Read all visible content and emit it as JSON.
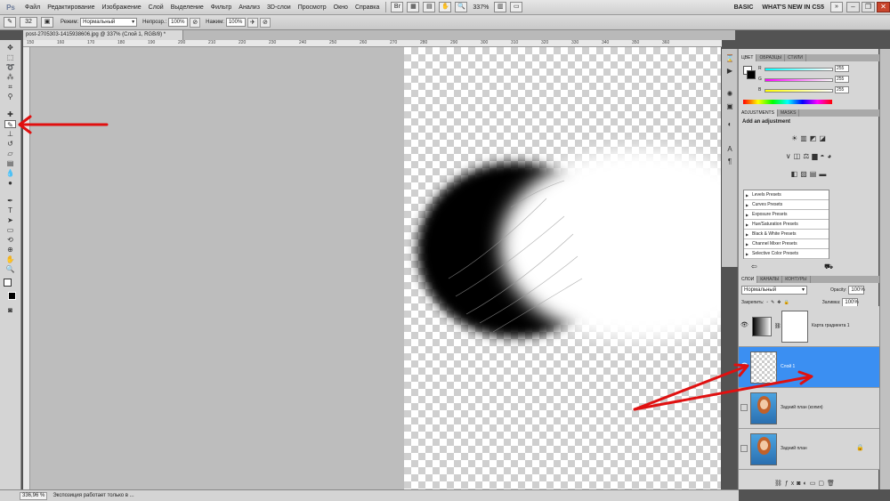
{
  "menubar": {
    "logo": "Ps",
    "items": [
      "Файл",
      "Редактирование",
      "Изображение",
      "Слой",
      "Выделение",
      "Фильтр",
      "Анализ",
      "3D-слои",
      "Просмотр",
      "Окно",
      "Справка"
    ],
    "zoom": "337%",
    "workspace_basic": "BASIC",
    "workspace_new": "WHAT'S NEW IN CS5",
    "win_min": "–",
    "win_restore": "❐",
    "win_close": "✕"
  },
  "options": {
    "mode_label": "Режим:",
    "mode_value": "Нормальный",
    "opacity_label": "Непрозр.:",
    "opacity_value": "100%",
    "pressure_label": "Нажим:",
    "pressure_value": "100%",
    "brush_size": "32"
  },
  "document": {
    "tab_title": "post-2705303-1415938606.jpg @ 337% (Слой 1, RGB/8) *",
    "ruler_marks": [
      "150",
      "160",
      "170",
      "180",
      "190",
      "200",
      "210",
      "220",
      "230",
      "240",
      "250",
      "260",
      "270",
      "280",
      "290",
      "300",
      "310",
      "320",
      "330",
      "340",
      "350",
      "360"
    ]
  },
  "status": {
    "zoom": "336,96 %",
    "info": "Экспозиция работает только в ..."
  },
  "color_panel": {
    "tabs": [
      "ЦВЕТ",
      "ОБРАЗЦЫ",
      "СТИЛИ"
    ],
    "r_label": "R",
    "g_label": "G",
    "b_label": "B",
    "r_value": "255",
    "g_value": "255",
    "b_value": "255"
  },
  "adjustments": {
    "tabs": [
      "ADJUSTMENTS",
      "MASKS"
    ],
    "title": "Add an adjustment",
    "presets": [
      "Levels Presets",
      "Curves Presets",
      "Exposure Presets",
      "Hue/Saturation Presets",
      "Black & White Presets",
      "Channel Mixer Presets",
      "Selective Color Presets"
    ]
  },
  "layers_panel": {
    "tabs": [
      "СЛОИ",
      "КАНАЛЫ",
      "КОНТУРЫ"
    ],
    "blend_mode": "Нормальный",
    "opacity_label": "Opacity:",
    "opacity_value": "100%",
    "lock_label": "Закрепить:",
    "fill_label": "Заливка:",
    "fill_value": "100%",
    "layers": [
      {
        "name": "Карта градиента 1"
      },
      {
        "name": "Слой 1"
      },
      {
        "name": "Задний план (копия)"
      },
      {
        "name": "Задний план"
      }
    ]
  },
  "colors": {
    "selection_blue": "#3b8ff2",
    "arrow_red": "#e01010"
  }
}
